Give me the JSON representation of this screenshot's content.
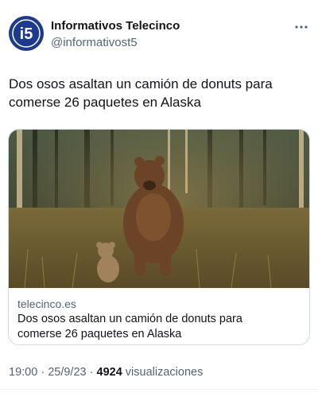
{
  "account": {
    "avatar_text": "i5",
    "display_name": "Informativos Telecinco",
    "handle": "@informativost5",
    "more_icon": "more-horizontal-icon",
    "brand_color": "#1d3a8c"
  },
  "tweet": {
    "text": "Dos osos asaltan un camión de donuts para comerse 26 paquetes en Alaska"
  },
  "card": {
    "image_alt": "bear-with-cub-in-forest",
    "domain": "telecinco.es",
    "title": "Dos osos asaltan un camión de donuts para comerse 26 paquetes en Alaska"
  },
  "meta": {
    "time": "19:00",
    "separator": "·",
    "date": "25/9/23",
    "views_count": "4924",
    "views_label": "visualizaciones"
  }
}
